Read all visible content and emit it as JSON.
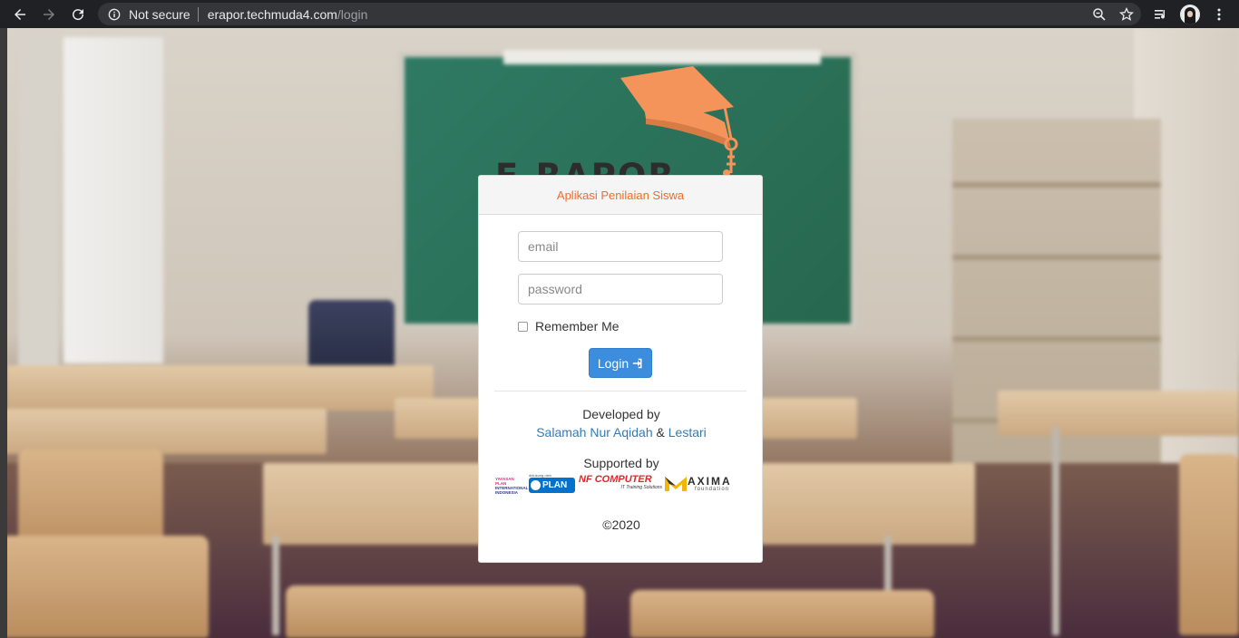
{
  "browser": {
    "security_label": "Not secure",
    "url_host": "erapor.techmuda4.com",
    "url_path": "/login"
  },
  "logo": {
    "text": "E-RAPOR",
    "accent_color": "#f4945a"
  },
  "login": {
    "header": "Aplikasi Penilaian Siswa",
    "email_placeholder": "email",
    "password_placeholder": "password",
    "remember_label": "Remember Me",
    "login_label": "Login",
    "login_icon": "sign-in-icon"
  },
  "credits": {
    "developed_by": "Developed by",
    "developer_1": "Salamah Nur Aqidah",
    "and": "&",
    "developer_2": "Lestari",
    "supported_by": "Supported by",
    "sponsors": {
      "yayasan_line1": "YAYASAN PLAN",
      "yayasan_line2": "INTERNATIONAL",
      "yayasan_line3": "INDONESIA",
      "plan_small": "didukung oleh",
      "plan": "PLAN",
      "plan_sub": "INTERNATIONAL",
      "nf": "NF COMPUTER",
      "nf_sub": "IT Training Solutions",
      "maxima": "AXIMA",
      "maxima_sub": "foundation"
    },
    "copyright": "©2020"
  },
  "colors": {
    "header_text": "#f26c2b",
    "button": "#3c8dde",
    "link": "#337ab7"
  }
}
